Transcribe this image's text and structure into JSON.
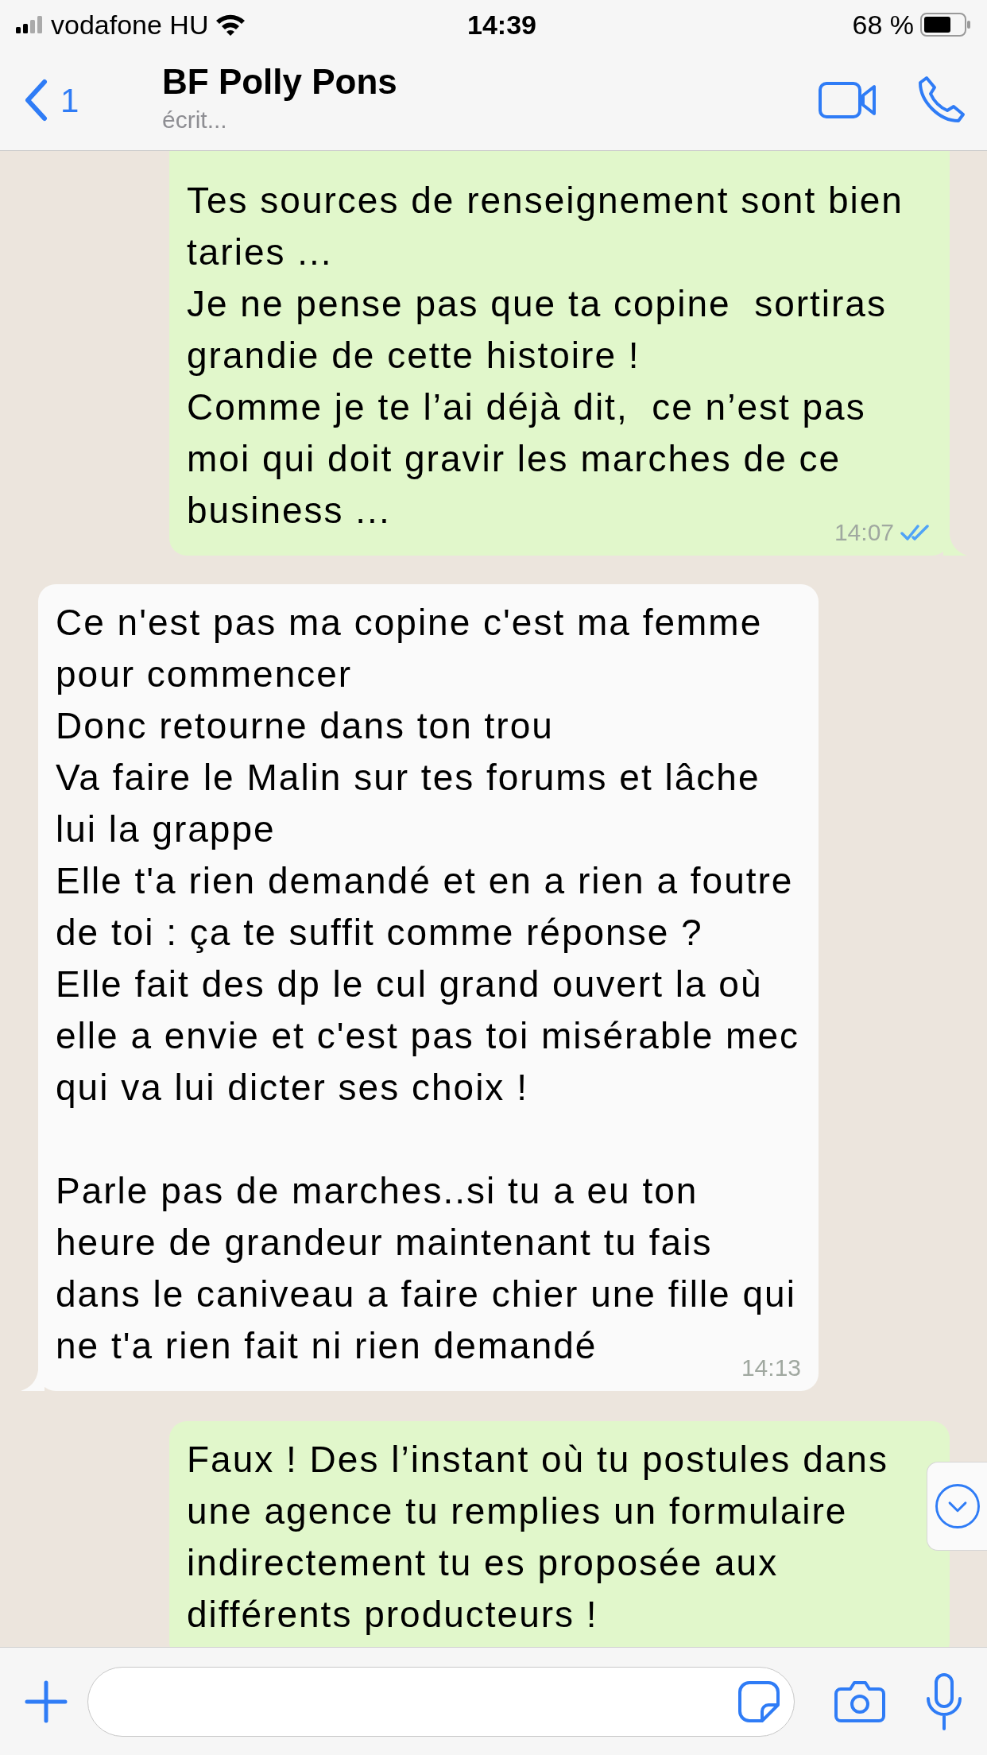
{
  "status_bar": {
    "carrier": "vodafone HU",
    "time": "14:39",
    "battery": "68 %"
  },
  "header": {
    "back_count": "1",
    "contact_name": "BF Polly Pons",
    "status": "écrit..."
  },
  "messages": [
    {
      "kind": "outgoing",
      "text": "Tes sources de renseignement sont bien taries ...\nJe ne pense pas que ta copine  sortiras grandie de cette histoire !\nComme je te l’ai déjà dit,  ce n’est pas moi qui doit gravir les marches de ce business ...",
      "time": "14:07",
      "read": true,
      "tail": true,
      "cut_top": true
    },
    {
      "kind": "incoming",
      "text": "Ce n'est pas ma copine c'est ma femme pour commencer\nDonc retourne dans ton trou\nVa faire le Malin sur tes forums et lâche lui la grappe\nElle t'a rien demandé et en a rien a foutre de toi : ça te suffit comme réponse ?\nElle fait des dp le cul grand ouvert la où elle a envie et c'est pas toi misérable mec qui va lui dicter ses choix !\n\nParle pas de marches..si tu a eu ton heure de grandeur maintenant tu fais dans le caniveau a faire chier une fille qui ne t'a rien fait ni rien demandé",
      "time": "14:13",
      "tail": true,
      "cut_top": false
    },
    {
      "kind": "outgoing",
      "text": "Faux ! Des l’instant où tu postules dans une agence tu remplies un formulaire indirectement tu es proposée aux différents producteurs !",
      "cut_top": false
    }
  ]
}
